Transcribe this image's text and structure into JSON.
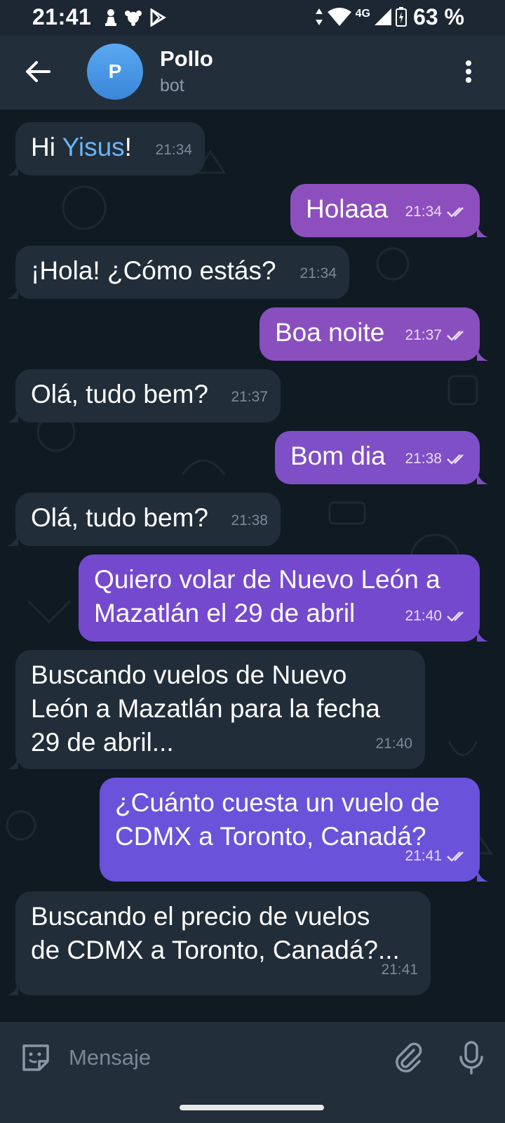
{
  "status_bar": {
    "time": "21:41",
    "network": "4G",
    "battery": "63 %"
  },
  "header": {
    "avatar_letter": "P",
    "name": "Pollo",
    "status": "bot"
  },
  "messages": [
    {
      "dir": "in",
      "text_before": "Hi ",
      "link": "Yisus",
      "text_after": "!",
      "time": "21:34"
    },
    {
      "dir": "out",
      "text": "Holaaa",
      "time": "21:34",
      "color": "#8d4fbd"
    },
    {
      "dir": "in",
      "text": "¡Hola! ¿Cómo estás?",
      "time": "21:34"
    },
    {
      "dir": "out",
      "text": "Boa noite",
      "time": "21:37",
      "color": "#8a4fbf"
    },
    {
      "dir": "in",
      "text": "Olá, tudo bem?",
      "time": "21:37"
    },
    {
      "dir": "out",
      "text": "Bom dia",
      "time": "21:38",
      "color": "#7e4fc6"
    },
    {
      "dir": "in",
      "text": "Olá, tudo bem?",
      "time": "21:38"
    },
    {
      "dir": "out",
      "text": "Quiero volar de Nuevo León a\nMazatlán el 29 de abril",
      "time": "21:40",
      "color": "#7449cd"
    },
    {
      "dir": "in",
      "text": "Buscando vuelos de Nuevo\nLeón a Mazatlán para la fecha\n29 de abril...",
      "time": "21:40"
    },
    {
      "dir": "out",
      "text": "¿Cuánto cuesta un vuelo de\nCDMX a Toronto, Canadá?",
      "time": "21:41",
      "color": "#6a52da"
    },
    {
      "dir": "in",
      "text": "Buscando el precio de vuelos\nde CDMX a Toronto, Canadá?...",
      "time": "21:41"
    }
  ],
  "input": {
    "placeholder": "Mensaje"
  },
  "colors": {
    "incoming_bubble": "#212d39",
    "link": "#6cb4f5",
    "header": "#222e3a"
  }
}
